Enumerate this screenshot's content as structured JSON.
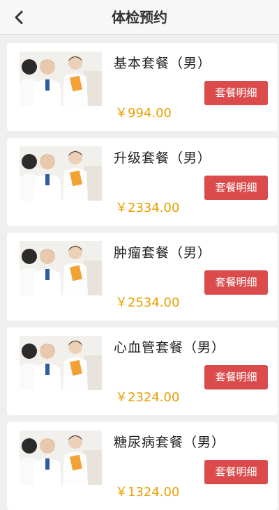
{
  "header": {
    "title": "体检预约",
    "back_icon": "chevron-left-icon"
  },
  "packages": [
    {
      "name": "基本套餐（男）",
      "price": "￥994.00",
      "button": "套餐明细"
    },
    {
      "name": "升级套餐（男）",
      "price": "￥2334.00",
      "button": "套餐明细"
    },
    {
      "name": "肿瘤套餐（男）",
      "price": "￥2534.00",
      "button": "套餐明细"
    },
    {
      "name": "心血管套餐（男）",
      "price": "￥2324.00",
      "button": "套餐明细"
    },
    {
      "name": "糖尿病套餐（男）",
      "price": "￥1324.00",
      "button": "套餐明细"
    }
  ],
  "colors": {
    "button": "#db4b4b",
    "price": "#e8a100",
    "background": "#efefef"
  }
}
